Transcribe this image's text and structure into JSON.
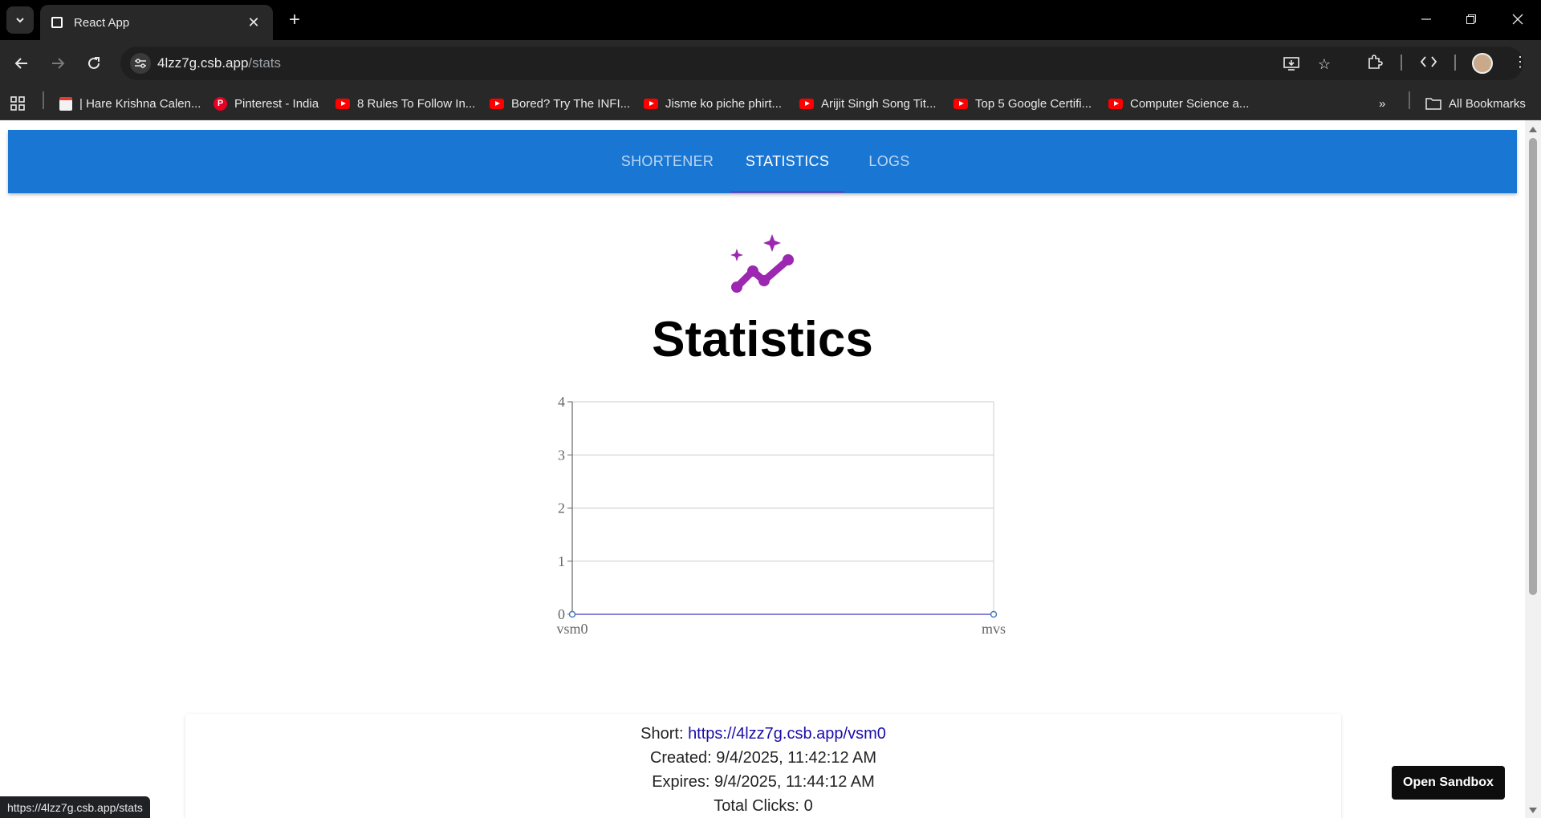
{
  "browser": {
    "tab_title": "React App",
    "url_host": "4lzz7g.csb.app",
    "url_path": "/stats",
    "status_url": "https://4lzz7g.csb.app/stats",
    "all_bookmarks_label": "All Bookmarks",
    "bookmarks": [
      {
        "label": "| Hare Krishna Calen...",
        "icon": "calendar-icon"
      },
      {
        "label": "Pinterest - India",
        "icon": "pinterest-icon"
      },
      {
        "label": "8 Rules To Follow In...",
        "icon": "youtube-icon"
      },
      {
        "label": "Bored? Try The INFI...",
        "icon": "youtube-icon"
      },
      {
        "label": "Jisme ko piche phirt...",
        "icon": "youtube-icon"
      },
      {
        "label": "Arijit Singh Song Tit...",
        "icon": "youtube-icon"
      },
      {
        "label": "Top 5 Google Certifi...",
        "icon": "youtube-icon"
      },
      {
        "label": "Computer Science a...",
        "icon": "youtube-icon"
      }
    ]
  },
  "app": {
    "tabs": [
      {
        "label": "SHORTENER",
        "active": false
      },
      {
        "label": "STATISTICS",
        "active": true
      },
      {
        "label": "LOGS",
        "active": false
      }
    ],
    "accent": "#1976d2",
    "indicator_color": "#9c27b0",
    "page_title": "Statistics",
    "hero_icon": "auto-graph-icon"
  },
  "chart_data": {
    "type": "line",
    "categories": [
      "vsm0",
      "mvs"
    ],
    "series": [
      {
        "values": [
          0,
          0
        ]
      }
    ],
    "ylim": [
      0,
      4
    ],
    "yticks": [
      "0",
      "1",
      "2",
      "3",
      "4"
    ],
    "grid": true,
    "title": "",
    "xlabel": "",
    "ylabel": ""
  },
  "stats": {
    "short_label": "Short:",
    "short_url": "https://4lzz7g.csb.app/vsm0",
    "created_label": "Created:",
    "created": "9/4/2025, 11:42:12 AM",
    "expires_label": "Expires:",
    "expires": "9/4/2025, 11:44:12 AM",
    "clicks_label": "Total Clicks:",
    "clicks": "0"
  },
  "sandbox_button": "Open Sandbox"
}
